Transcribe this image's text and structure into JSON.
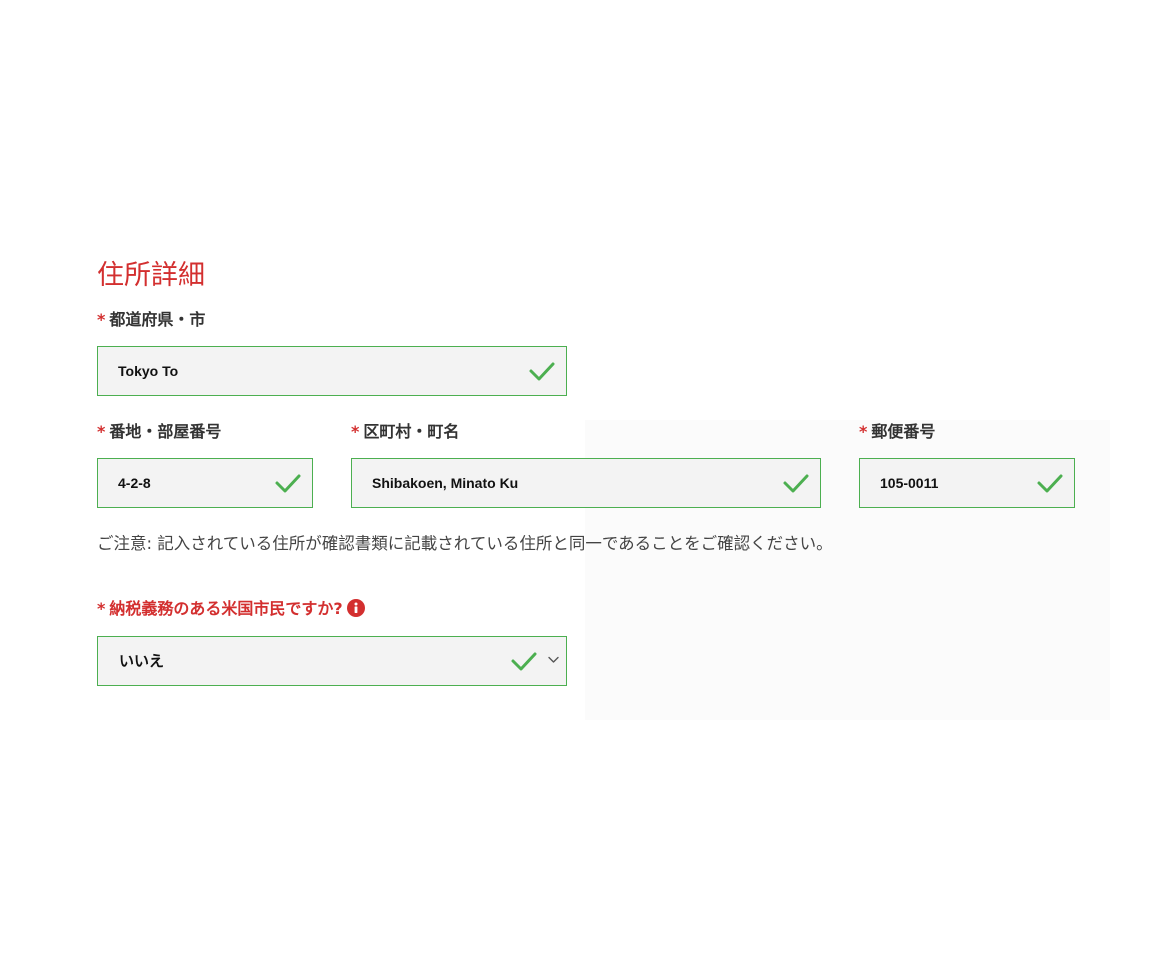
{
  "section": {
    "title": "住所詳細"
  },
  "required_mark": "*",
  "prefecture": {
    "label": "都道府県・市",
    "value": "Tokyo To"
  },
  "address_line": {
    "label": "番地・部屋番号",
    "value": "4-2-8"
  },
  "town": {
    "label": "区町村・町名",
    "value": "Shibakoen, Minato Ku"
  },
  "postal_code": {
    "label": "郵便番号",
    "value": "105-0011"
  },
  "notice": "ご注意: 記入されている住所が確認書類に記載されている住所と同一であることをご確認ください。",
  "us_citizen": {
    "label": "納税義務のある米国市民ですか?",
    "selected": "いいえ"
  },
  "colors": {
    "accent_red": "#d32f2f",
    "valid_green": "#4caf50",
    "field_bg": "#f3f3f3"
  },
  "icons": {
    "valid": "check-icon",
    "info": "info-icon",
    "dropdown": "chevron-down-icon"
  }
}
